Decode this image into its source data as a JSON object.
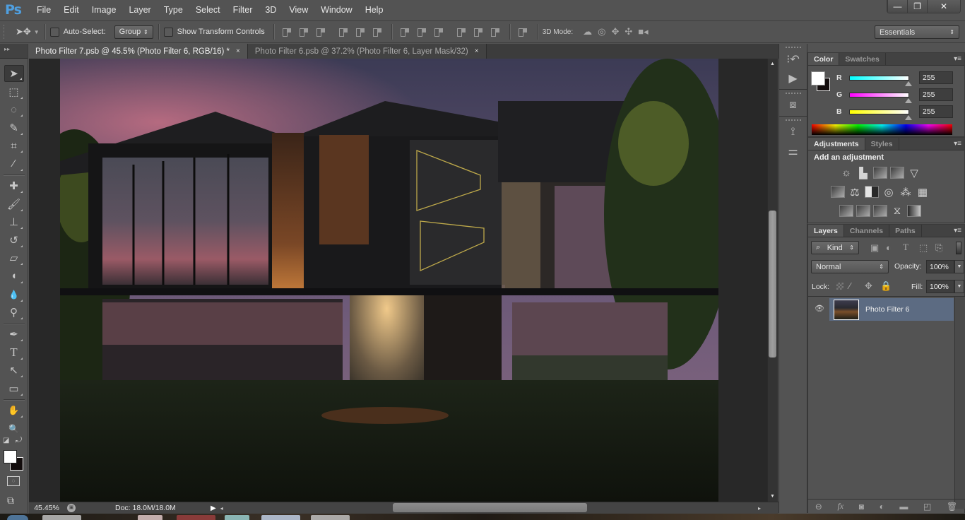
{
  "app": {
    "logo": "Ps",
    "name": "Adobe Photoshop"
  },
  "menu": [
    "File",
    "Edit",
    "Image",
    "Layer",
    "Type",
    "Select",
    "Filter",
    "3D",
    "View",
    "Window",
    "Help"
  ],
  "window_controls": {
    "minimize": "—",
    "restore": "❐",
    "close": "✕"
  },
  "options_bar": {
    "tool_icon": "move-tool-icon",
    "auto_select_label": "Auto-Select:",
    "auto_select_checked": false,
    "auto_select_target": "Group",
    "show_transform_label": "Show Transform Controls",
    "show_transform_checked": false,
    "mode_3d_label": "3D Mode:",
    "workspace": "Essentials"
  },
  "tabs": [
    {
      "label": "Photo Filter 7.psb @ 45.5% (Photo Filter 6, RGB/16) *",
      "active": true,
      "close": "×"
    },
    {
      "label": "Photo Filter 6.psb @ 37.2% (Photo Filter 6, Layer Mask/32)",
      "active": false,
      "close": "×"
    }
  ],
  "tools": [
    {
      "name": "move-tool",
      "glyph": "➤"
    },
    {
      "name": "rectangular-marquee-tool",
      "glyph": "⬚"
    },
    {
      "name": "lasso-tool",
      "glyph": "◌"
    },
    {
      "name": "quick-selection-tool",
      "glyph": "✎"
    },
    {
      "name": "crop-tool",
      "glyph": "⌗"
    },
    {
      "name": "eyedropper-tool",
      "glyph": "⁄"
    },
    {
      "name": "healing-brush-tool",
      "glyph": "✚"
    },
    {
      "name": "brush-tool",
      "glyph": "🖌"
    },
    {
      "name": "clone-stamp-tool",
      "glyph": "⊥"
    },
    {
      "name": "history-brush-tool",
      "glyph": "↺"
    },
    {
      "name": "eraser-tool",
      "glyph": "▱"
    },
    {
      "name": "paint-bucket-tool",
      "glyph": "◖"
    },
    {
      "name": "blur-tool",
      "glyph": "💧"
    },
    {
      "name": "dodge-tool",
      "glyph": "⚲"
    },
    {
      "name": "pen-tool",
      "glyph": "✒"
    },
    {
      "name": "type-tool",
      "glyph": "T"
    },
    {
      "name": "path-selection-tool",
      "glyph": "↖"
    },
    {
      "name": "rectangle-tool",
      "glyph": "▭"
    },
    {
      "name": "hand-tool",
      "glyph": "✋"
    },
    {
      "name": "zoom-tool",
      "glyph": "🔍"
    }
  ],
  "colors": {
    "foreground": "#ffffff",
    "background": "#120c0c",
    "accent": "#4f9fe0",
    "layer_selected": "#5c6b82"
  },
  "status": {
    "zoom": "45.45%",
    "doc": "Doc: 18.0M/18.0M"
  },
  "color_panel": {
    "tabs": [
      "Color",
      "Swatches"
    ],
    "channels": [
      {
        "label": "R",
        "value": "255",
        "gradient": "#00ffff"
      },
      {
        "label": "G",
        "value": "255",
        "gradient": "#ff00ff"
      },
      {
        "label": "B",
        "value": "255",
        "gradient": "#ffff00"
      }
    ]
  },
  "adjustments_panel": {
    "tabs": [
      "Adjustments",
      "Styles"
    ],
    "title": "Add an adjustment",
    "rows": [
      [
        "brightness-contrast",
        "levels",
        "curves",
        "exposure",
        "vibrance"
      ],
      [
        "hue-saturation",
        "color-balance",
        "black-white",
        "photo-filter",
        "channel-mixer",
        "color-lookup"
      ],
      [
        "invert",
        "posterize",
        "threshold",
        "selective-color",
        "gradient-map"
      ]
    ]
  },
  "layers_panel": {
    "tabs": [
      "Layers",
      "Channels",
      "Paths"
    ],
    "filter_kind": "Kind",
    "blend_mode": "Normal",
    "opacity_label": "Opacity:",
    "opacity": "100%",
    "lock_label": "Lock:",
    "fill_label": "Fill:",
    "fill": "100%",
    "layers": [
      {
        "name": "Photo Filter 6",
        "visible": true,
        "selected": true,
        "smart_object": true
      }
    ],
    "footer_icons": [
      "link-layers-icon",
      "fx-icon",
      "add-mask-icon",
      "adjustment-layer-icon",
      "new-group-icon",
      "new-layer-icon",
      "delete-layer-icon"
    ]
  }
}
